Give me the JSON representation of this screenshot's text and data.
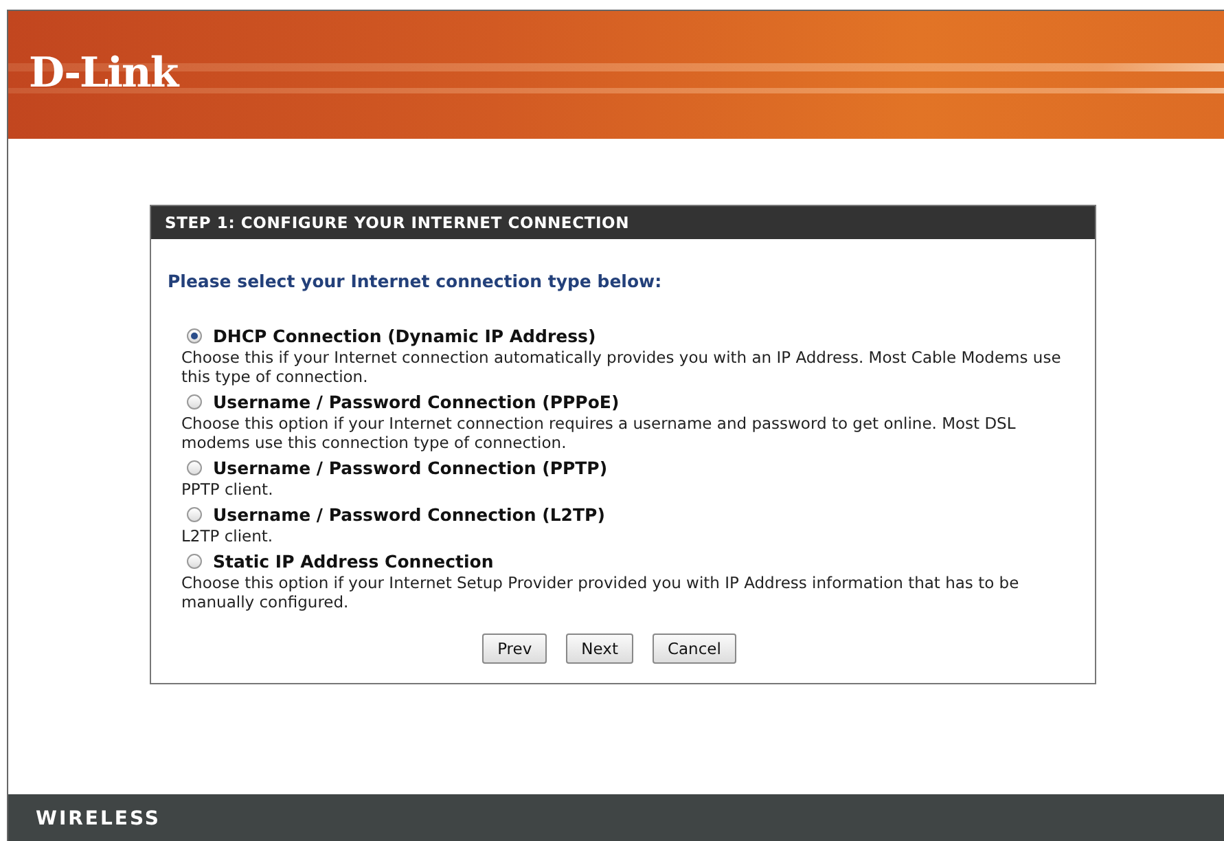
{
  "header": {
    "logo": "D-Link"
  },
  "panel": {
    "title": "STEP 1: CONFIGURE YOUR INTERNET CONNECTION",
    "prompt": "Please select your Internet connection type below:",
    "options": [
      {
        "label": "DHCP Connection (Dynamic IP Address)",
        "description": "Choose this if your Internet connection automatically provides you with an IP Address. Most Cable Modems use this type of connection.",
        "selected": true
      },
      {
        "label": "Username / Password Connection (PPPoE)",
        "description": "Choose this option if your Internet connection requires a username and password to get online. Most DSL modems use this connection type of connection.",
        "selected": false
      },
      {
        "label": "Username / Password Connection (PPTP)",
        "description": "PPTP client.",
        "selected": false
      },
      {
        "label": "Username / Password Connection (L2TP)",
        "description": "L2TP client.",
        "selected": false
      },
      {
        "label": "Static IP Address Connection",
        "description": "Choose this option if your Internet Setup Provider provided you with IP Address information that has to be manually configured.",
        "selected": false
      }
    ],
    "buttons": [
      "Prev",
      "Next",
      "Cancel"
    ]
  },
  "footer": {
    "label": "WIRELESS"
  }
}
